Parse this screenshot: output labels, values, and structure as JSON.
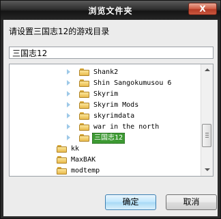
{
  "window": {
    "title": "浏览文件夹",
    "close_label": "X"
  },
  "prompt": "请设置三国志12的游戏目录",
  "path_input": {
    "value": "三国志12"
  },
  "tree": {
    "items": [
      {
        "label": "Shank2",
        "expander": true,
        "selected": false
      },
      {
        "label": "Shin Sangokumusou 6",
        "expander": true,
        "selected": false
      },
      {
        "label": "Skyrim",
        "expander": true,
        "selected": false
      },
      {
        "label": "Skyrim Mods",
        "expander": true,
        "selected": false
      },
      {
        "label": "skyrimdata",
        "expander": true,
        "selected": false
      },
      {
        "label": "war in the north",
        "expander": true,
        "selected": false
      },
      {
        "label": "三国志12",
        "expander": true,
        "selected": true
      },
      {
        "label": "kk",
        "expander": false,
        "selected": false
      },
      {
        "label": "MaxBAK",
        "expander": false,
        "selected": false
      },
      {
        "label": "modtemp",
        "expander": false,
        "selected": false
      },
      {
        "label": "",
        "expander": false,
        "selected": false
      }
    ]
  },
  "buttons": {
    "ok": "确定",
    "cancel": "取消"
  }
}
